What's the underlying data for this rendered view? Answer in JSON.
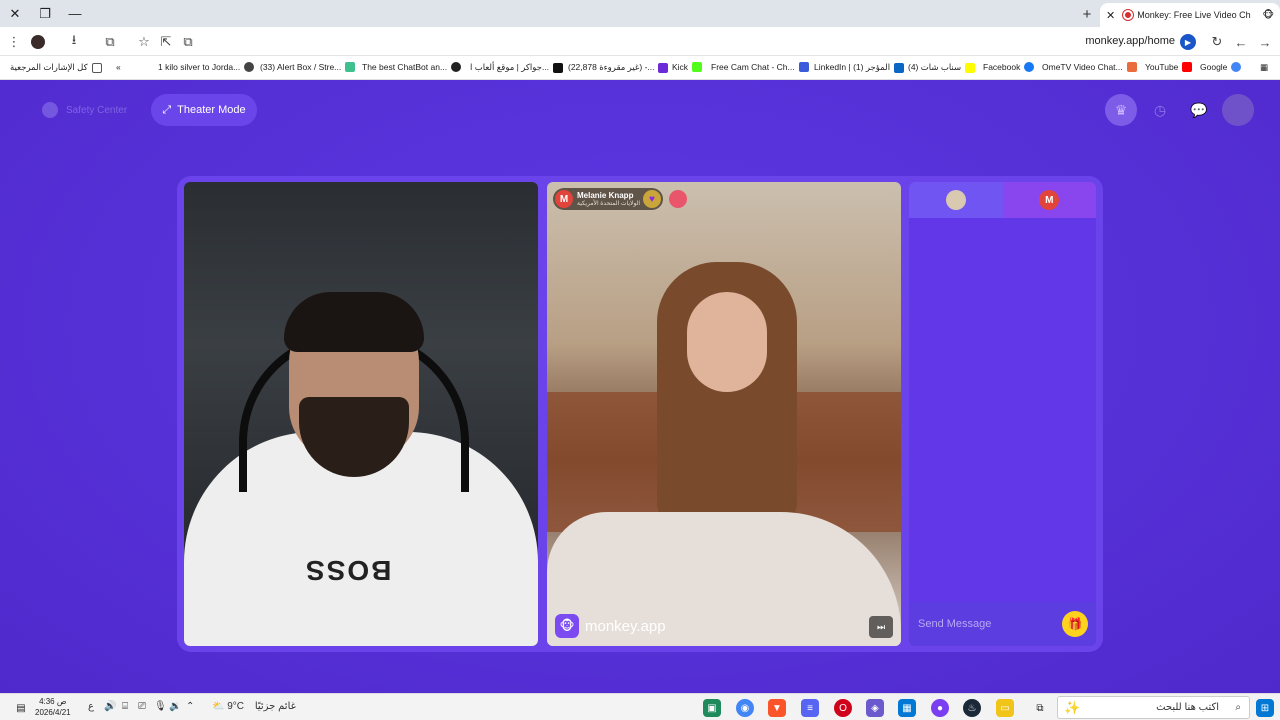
{
  "browser": {
    "tab_title": "Monkey: Free Live Video Ch",
    "url": "monkey.app/home",
    "bookmarks": [
      {
        "label": "كل الإشارات المرجعية",
        "color": "#555555"
      },
      {
        "label": "1 kilo silver to Jorda...",
        "color": "#444444"
      },
      {
        "label": "(33) Alert Box / Stre...",
        "color": "#3ec18e"
      },
      {
        "label": "The best ChatBot an...",
        "color": "#222222"
      },
      {
        "label": "جواكر | موقع ألعاب ا...",
        "color": "#111111"
      },
      {
        "label": "(22,878 غير مقروءة) -...",
        "color": "#6c2bd9"
      },
      {
        "label": "Kick",
        "color": "#53fc18"
      },
      {
        "label": "Free Cam Chat - Ch...",
        "color": "#3b5bdb"
      },
      {
        "label": "LinkedIn | المؤجر (1)",
        "color": "#0a66c2"
      },
      {
        "label": "(4) سناب شات",
        "color": "#fffc00"
      },
      {
        "label": "Facebook",
        "color": "#1877f2"
      },
      {
        "label": "OmeTV Video Chat...",
        "color": "#e86c3c"
      },
      {
        "label": "YouTube",
        "color": "#ff0000"
      },
      {
        "label": "Google",
        "color": "#4285f4"
      }
    ]
  },
  "page": {
    "safety_center": "Safety Center",
    "theater_mode": "Theater Mode"
  },
  "stage": {
    "partner": {
      "initial": "M",
      "name": "Melanie Knapp",
      "location": "الولايات المتحدة الأمريكية"
    },
    "watermark": "monkey.app",
    "chat": {
      "tab2_initial": "M",
      "placeholder": "Send Message"
    }
  },
  "taskbar": {
    "search_placeholder": "اكتب هنا للبحث",
    "weather_temp": "9°C",
    "weather_text": "غائم جزئيًا",
    "lang": "ع",
    "time": "4:36 ص",
    "date": "2026/4/21"
  },
  "colors": {
    "page_bg": "#5a33dd",
    "stage_bg": "#6a43ea",
    "accent": "#ffd21e"
  }
}
